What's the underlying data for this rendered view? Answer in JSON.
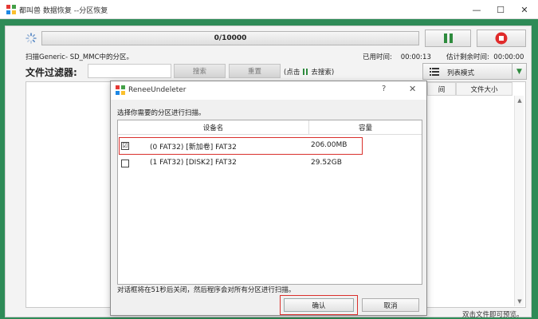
{
  "window": {
    "title": "都叫兽 数据恢复 --分区恢复",
    "minimize": "—",
    "maximize": "☐",
    "close": "✕"
  },
  "scan": {
    "progress_text": "0/10000",
    "info": "扫描Generic- SD_MMC中的分区。",
    "elapsed_label": "已用时间:",
    "elapsed_value": "00:00:13",
    "remaining_label": "估计剩余时间:",
    "remaining_value": "00:00:00"
  },
  "filter": {
    "label": "文件过滤器:",
    "input_value": "",
    "search_label": "搜索",
    "reset_label": "重置",
    "hint_prefix": "(点击",
    "hint_suffix": "去搜索)"
  },
  "view": {
    "mode_label": "列表模式",
    "arrow": "▼"
  },
  "file_list": {
    "columns": [
      "间",
      "文件大小"
    ],
    "preview_hint": "双击文件即可预览。"
  },
  "dialog": {
    "title": "ReneeUndeleter",
    "help": "?",
    "close": "✕",
    "prompt": "选择你需要的分区进行扫描。",
    "headers": {
      "device": "设备名",
      "capacity": "容量"
    },
    "rows": [
      {
        "checked": "☑",
        "device": "(0 FAT32) [新加卷] FAT32",
        "capacity": "206.00MB"
      },
      {
        "checked": "",
        "device": "(1 FAT32) [DISK2] FAT32",
        "capacity": "29.52GB"
      }
    ],
    "countdown": "对话框将在51秒后关闭，然后程序会对所有分区进行扫描。",
    "ok_label": "确认",
    "cancel_label": "取消"
  },
  "colors": {
    "background": "#2e8b57",
    "highlight": "#d9302c",
    "pause_green": "#2e8b3e",
    "stop_red": "#e02b2b"
  }
}
